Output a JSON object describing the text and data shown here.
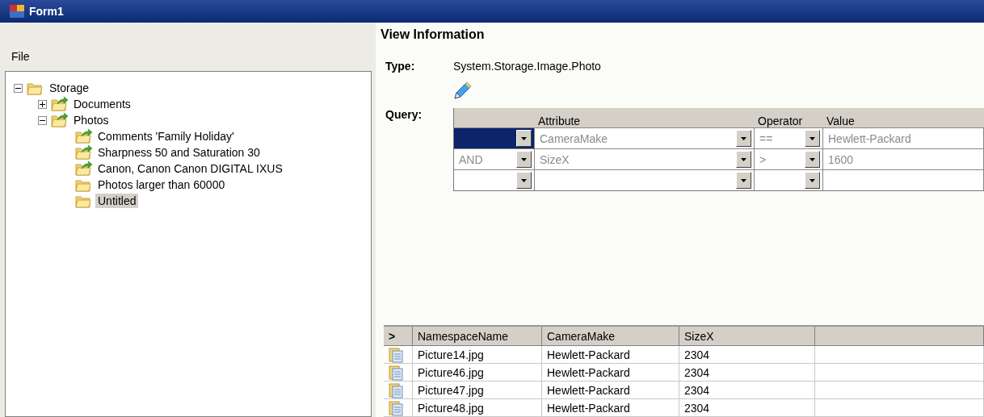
{
  "window": {
    "title": "Form1"
  },
  "menu": [
    {
      "label": "File"
    }
  ],
  "tree": [
    {
      "label": "Storage",
      "expanded": true,
      "selected": false,
      "kind": "folder",
      "children": [
        {
          "label": "Documents",
          "expanded": false,
          "selected": false,
          "kind": "smart"
        },
        {
          "label": "Photos",
          "expanded": true,
          "selected": false,
          "kind": "smart",
          "children": [
            {
              "label": "Comments 'Family Holiday'",
              "selected": false,
              "kind": "smart"
            },
            {
              "label": "Sharpness 50 and Saturation 30",
              "selected": false,
              "kind": "smart"
            },
            {
              "label": "Canon, Canon Canon DIGITAL IXUS",
              "selected": false,
              "kind": "smart"
            },
            {
              "label": "Photos larger than 60000",
              "selected": false,
              "kind": "folder"
            },
            {
              "label": "Untitled",
              "selected": true,
              "kind": "folder"
            }
          ]
        }
      ]
    }
  ],
  "view": {
    "title": "View Information",
    "type_label": "Type:",
    "type_value": "System.Storage.Image.Photo",
    "query_label": "Query:",
    "query_columns": [
      "Attribute",
      "Operator",
      "Value"
    ],
    "query_rows": [
      {
        "attribute": "CameraMake",
        "operator": "==",
        "value": "Hewlett-Packard",
        "selected": true
      },
      {
        "conjunction": "AND",
        "attribute": "SizeX",
        "operator": ">",
        "value": "1600",
        "selected": false
      },
      {
        "selected": false
      }
    ]
  },
  "results": {
    "header_marker": ">",
    "columns": [
      "NamespaceName",
      "CameraMake",
      "SizeX"
    ],
    "rows": [
      [
        "Picture14.jpg",
        "Hewlett-Packard",
        "2304"
      ],
      [
        "Picture46.jpg",
        "Hewlett-Packard",
        "2304"
      ],
      [
        "Picture47.jpg",
        "Hewlett-Packard",
        "2304"
      ],
      [
        "Picture48.jpg",
        "Hewlett-Packard",
        "2304"
      ]
    ]
  }
}
